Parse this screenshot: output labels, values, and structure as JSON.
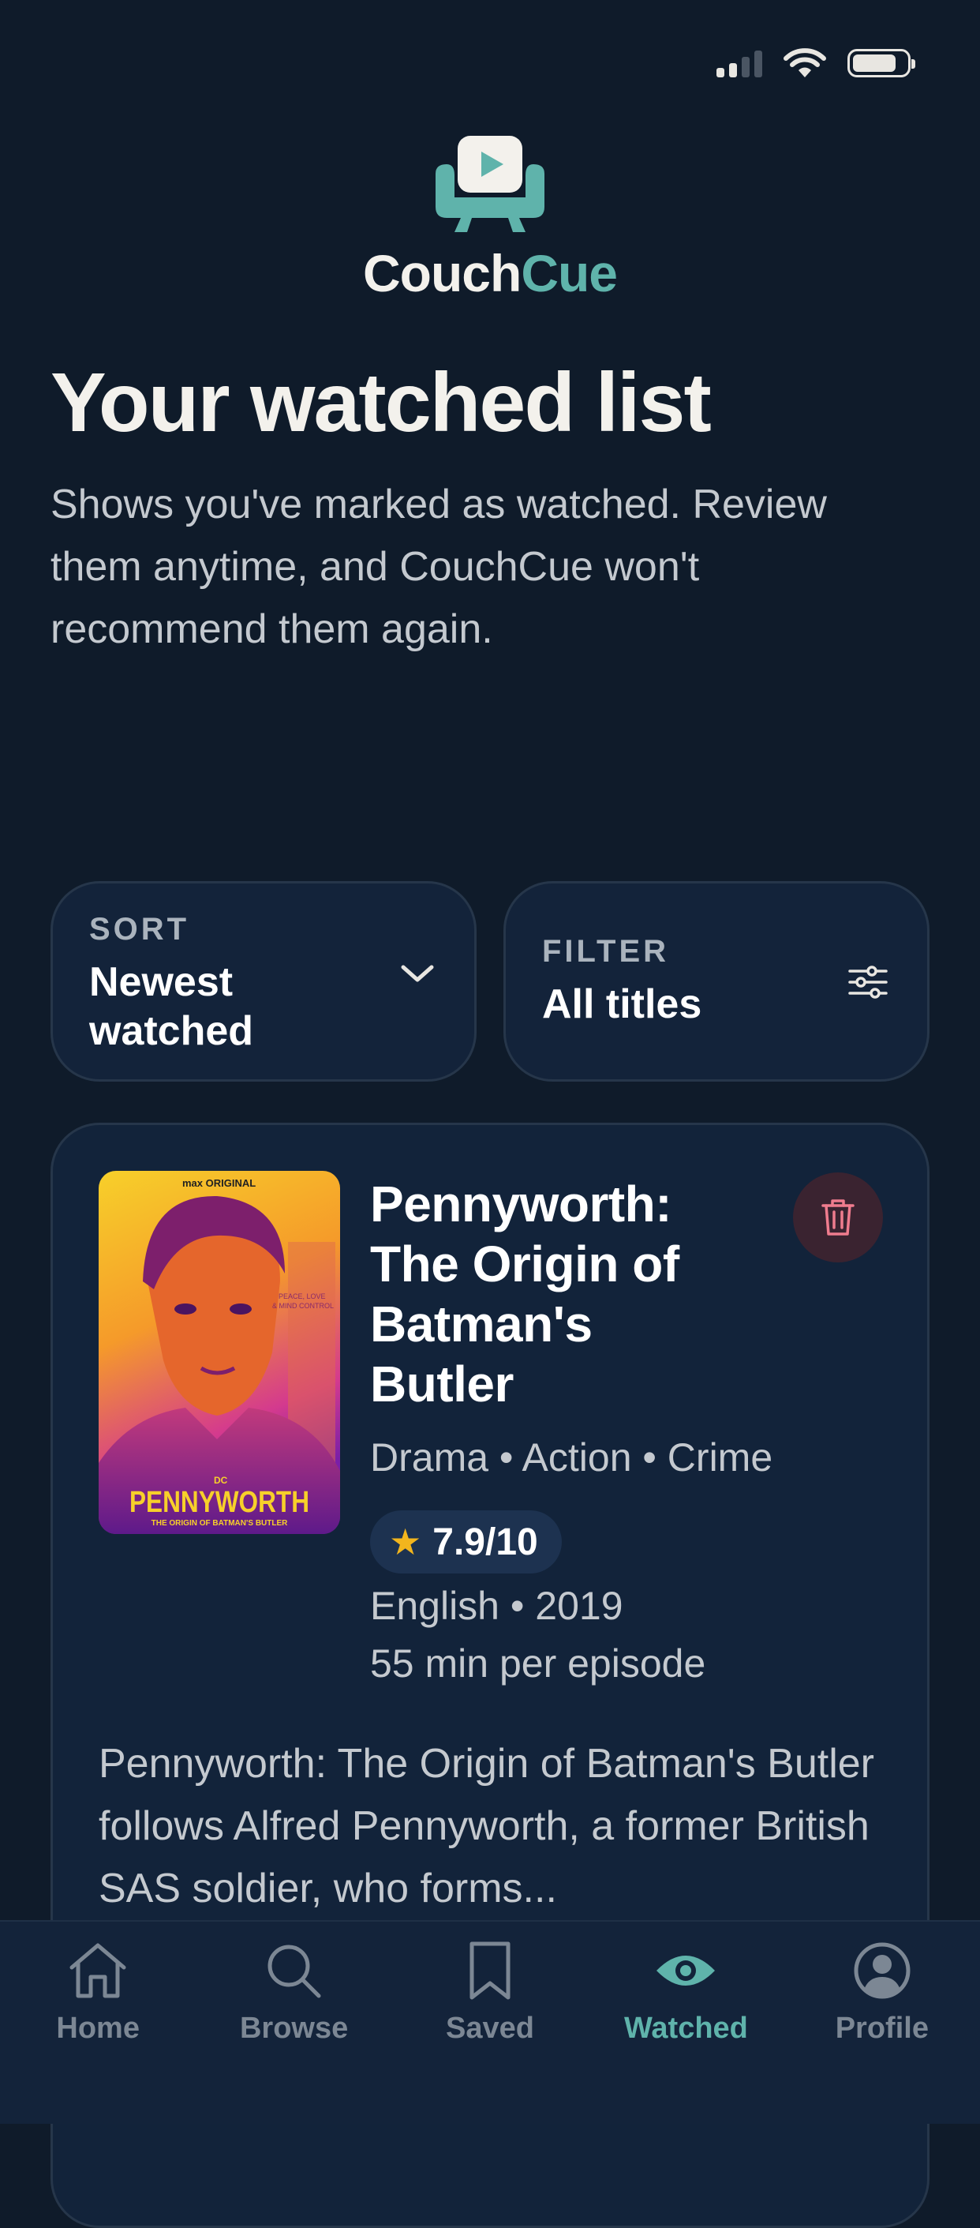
{
  "brand": {
    "name_part1": "Couch",
    "name_part2": "Cue",
    "accent_color": "#5fb3ab"
  },
  "page": {
    "title": "Your watched list",
    "subtitle": "Shows you've marked as watched. Review them anytime, and CouchCue won't recommend them again."
  },
  "controls": {
    "sort": {
      "label": "SORT",
      "value": "Newest watched",
      "icon": "chevron-down-icon"
    },
    "filter": {
      "label": "FILTER",
      "value": "All titles",
      "icon": "sliders-icon"
    }
  },
  "show": {
    "title": "Pennyworth: The Origin of Batman's Butler",
    "genres": "Drama • Action • Crime",
    "rating": "7.9/10",
    "language_year": "English • 2019",
    "runtime": "55 min per episode",
    "description": "Pennyworth: The Origin of Batman's Butler follows Alfred Pennyworth, a former British SAS soldier, who forms...",
    "poster": {
      "badge": "max ORIGINAL",
      "tagline": "PEACE, LOVE & MIND CONTROL",
      "dc": "DC",
      "wordmark": "PENNYWORTH",
      "subline": "THE ORIGIN OF BATMAN'S BUTLER"
    }
  },
  "tabs": [
    {
      "label": "Home",
      "icon": "home-icon",
      "active": false
    },
    {
      "label": "Browse",
      "icon": "search-icon",
      "active": false
    },
    {
      "label": "Saved",
      "icon": "bookmark-icon",
      "active": false
    },
    {
      "label": "Watched",
      "icon": "eye-icon",
      "active": true
    },
    {
      "label": "Profile",
      "icon": "profile-icon",
      "active": false
    }
  ]
}
